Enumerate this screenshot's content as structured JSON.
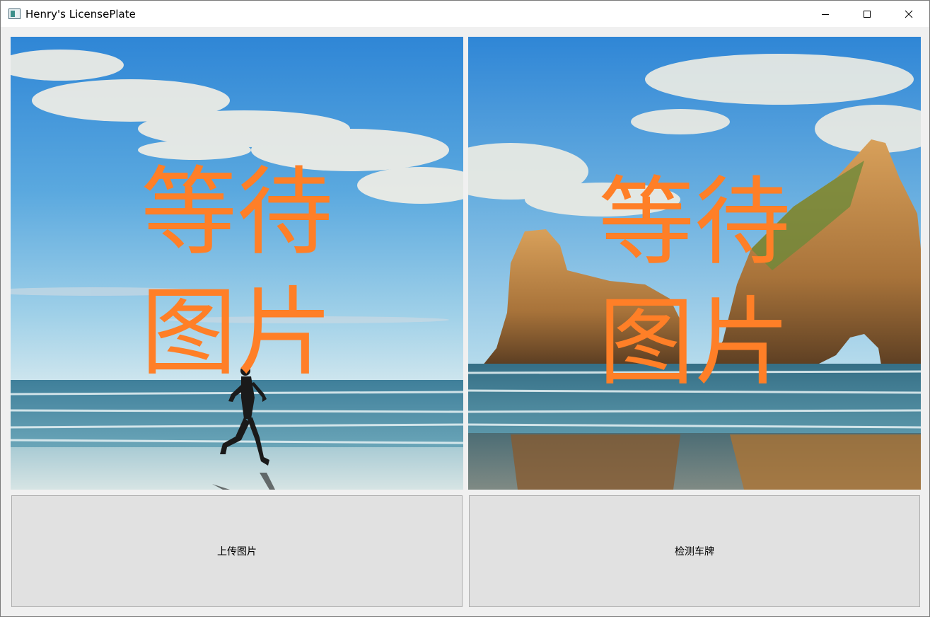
{
  "window": {
    "title": "Henry's LicensePlate",
    "controls": [
      "minimize-icon",
      "maximize-icon",
      "close-icon"
    ]
  },
  "panes": {
    "left": {
      "placeholder_line1": "等待",
      "placeholder_line2": "图片"
    },
    "right": {
      "placeholder_line1": "等待",
      "placeholder_line2": "图片"
    }
  },
  "buttons": {
    "upload_label": "上传图片",
    "detect_label": "检测车牌"
  },
  "colors": {
    "placeholder_text": "#ff7f27",
    "button_bg": "#e1e1e1",
    "button_border": "#adadad"
  }
}
